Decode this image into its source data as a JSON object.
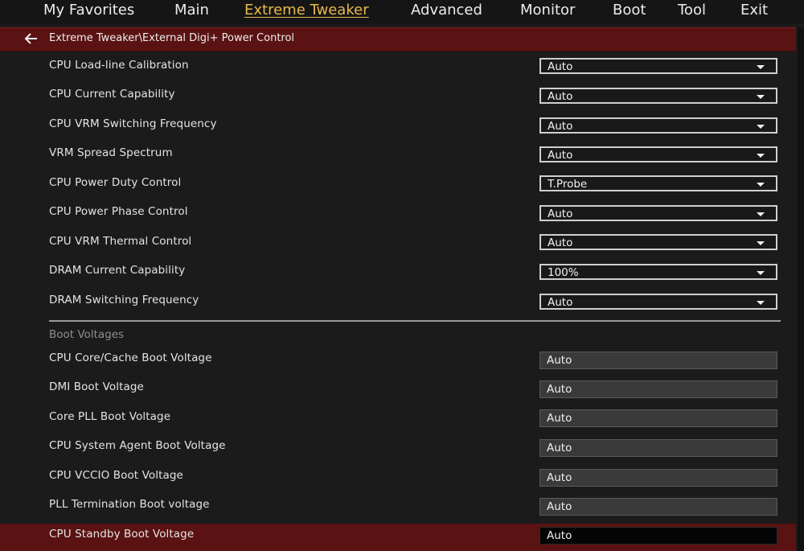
{
  "nav": {
    "tabs": [
      {
        "label": "My Favorites"
      },
      {
        "label": "Main"
      },
      {
        "label": "Extreme Tweaker"
      },
      {
        "label": "Advanced"
      },
      {
        "label": "Monitor"
      },
      {
        "label": "Boot"
      },
      {
        "label": "Tool"
      },
      {
        "label": "Exit"
      }
    ],
    "active_tab": "Extreme Tweaker"
  },
  "breadcrumb": {
    "back_icon": "left-arrow-icon",
    "path": "Extreme Tweaker\\External Digi+ Power Control"
  },
  "settings": [
    {
      "label": "CPU Load-line Calibration",
      "value": "Auto"
    },
    {
      "label": "CPU Current Capability",
      "value": "Auto"
    },
    {
      "label": "CPU VRM Switching Frequency",
      "value": "Auto"
    },
    {
      "label": "VRM Spread Spectrum",
      "value": "Auto"
    },
    {
      "label": "CPU Power Duty Control",
      "value": "T.Probe"
    },
    {
      "label": "CPU Power Phase Control",
      "value": "Auto"
    },
    {
      "label": "CPU VRM Thermal Control",
      "value": "Auto"
    },
    {
      "label": "DRAM Current Capability",
      "value": "100%"
    },
    {
      "label": "DRAM Switching Frequency",
      "value": "Auto"
    }
  ],
  "boot_voltages": {
    "heading": "Boot Voltages",
    "items": [
      {
        "label": "CPU Core/Cache Boot Voltage",
        "value": "Auto"
      },
      {
        "label": "DMI Boot Voltage",
        "value": "Auto"
      },
      {
        "label": "Core PLL Boot Voltage",
        "value": "Auto"
      },
      {
        "label": "CPU System Agent Boot Voltage",
        "value": "Auto"
      },
      {
        "label": "CPU VCCIO Boot Voltage",
        "value": "Auto"
      },
      {
        "label": "PLL Termination Boot voltage",
        "value": "Auto"
      },
      {
        "label": "CPU Standby Boot Voltage",
        "value": "Auto"
      }
    ],
    "selected_index": 6
  },
  "colors": {
    "accent": "#e8b84a",
    "highlight": "#5a1212",
    "background": "#1b1b1b"
  }
}
